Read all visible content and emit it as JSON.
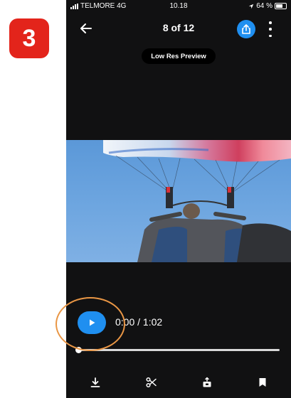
{
  "tutorial": {
    "step_number": "3",
    "step_color": "#e3241b",
    "highlight_color": "#e99645"
  },
  "status_bar": {
    "carrier": "TELMORE 4G",
    "time": "10.18",
    "battery_percent": "64 %"
  },
  "header": {
    "counter": "8 of 12",
    "share_color": "#1f8ff0"
  },
  "preview": {
    "label": "Low Res Preview"
  },
  "player": {
    "time": "0:00 / 1:02",
    "progress": 0.0
  },
  "toolbar": {
    "icons": [
      "download-icon",
      "scissors-icon",
      "export-icon",
      "bookmark-icon"
    ]
  }
}
